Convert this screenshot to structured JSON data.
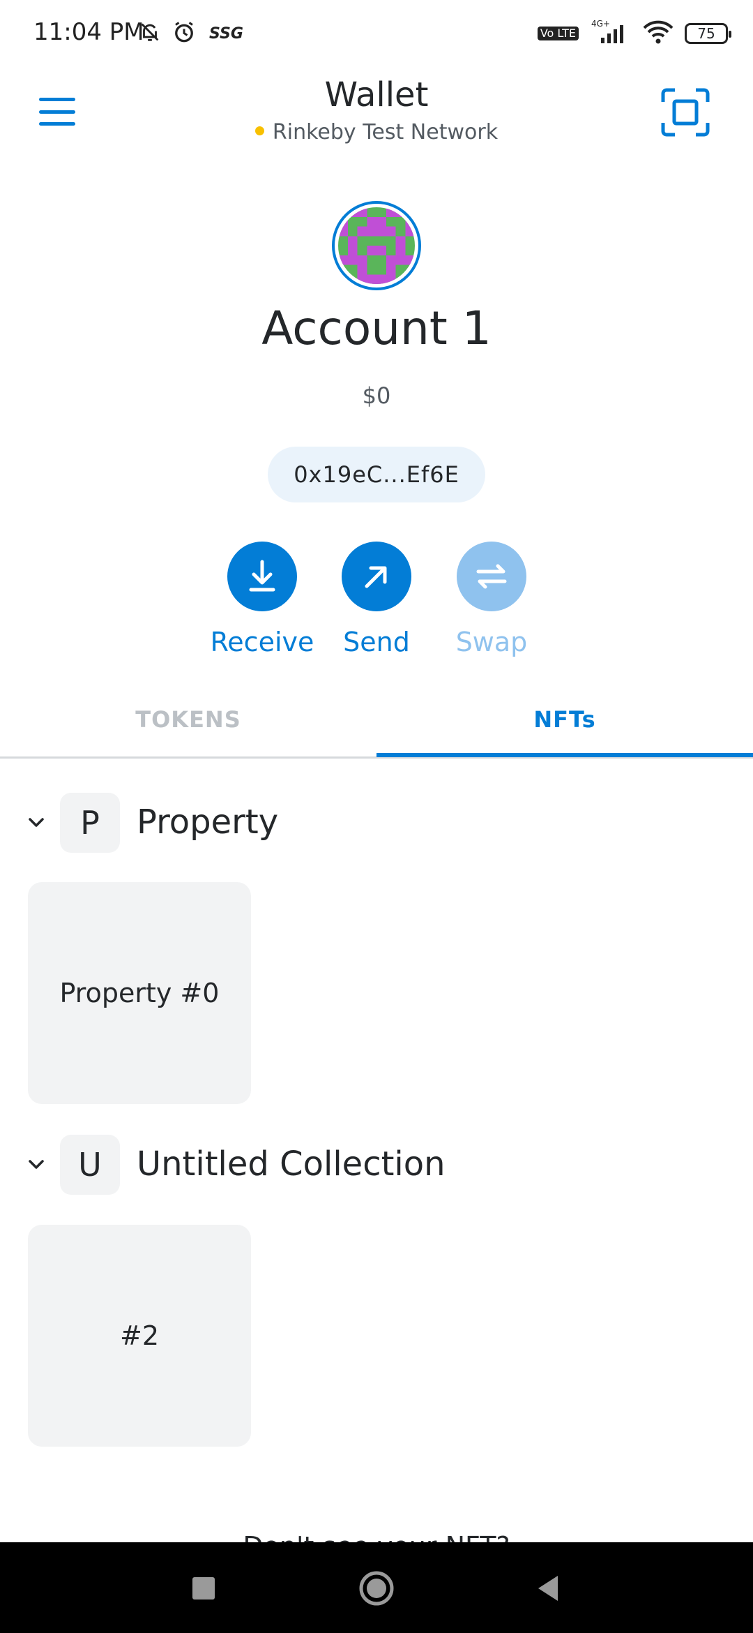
{
  "status_bar": {
    "time": "11:04 PM",
    "network_speed": "SSG",
    "volte": "Vo LTE",
    "signal_type": "4G+",
    "battery": "75"
  },
  "header": {
    "title": "Wallet",
    "network": "Rinkeby Test Network",
    "network_dot_color": "#f8c000"
  },
  "account": {
    "name": "Account 1",
    "balance": "$0",
    "address": "0x19eC...Ef6E"
  },
  "actions": [
    {
      "label": "Receive",
      "icon": "download-icon",
      "enabled": true
    },
    {
      "label": "Send",
      "icon": "arrow-up-right-icon",
      "enabled": true
    },
    {
      "label": "Swap",
      "icon": "swap-icon",
      "enabled": false
    }
  ],
  "tabs": [
    {
      "label": "TOKENS",
      "active": false
    },
    {
      "label": "NFTs",
      "active": true
    }
  ],
  "collections": [
    {
      "letter": "P",
      "name": "Property",
      "items": [
        "Property #0"
      ]
    },
    {
      "letter": "U",
      "name": "Untitled Collection",
      "items": [
        "#2"
      ]
    }
  ],
  "footer_text": "Don't see your NFT?",
  "colors": {
    "accent": "#037dd6",
    "accent_disabled": "#8fc2ee"
  }
}
